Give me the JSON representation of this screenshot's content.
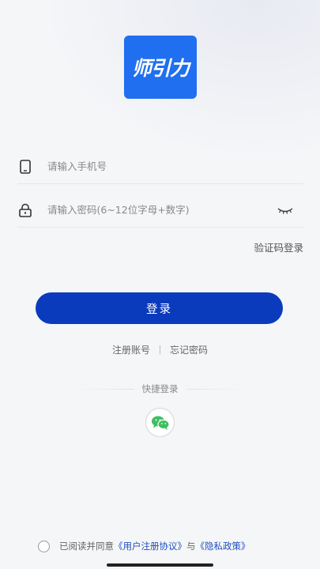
{
  "logo": {
    "text": "师引力"
  },
  "phone": {
    "placeholder": "请输入手机号"
  },
  "password": {
    "placeholder": "请输入密码(6~12位字母+数字)"
  },
  "sms_login": "验证码登录",
  "login_button": "登录",
  "links": {
    "register": "注册账号",
    "forgot": "忘记密码"
  },
  "quick_login": "快捷登录",
  "agreement": {
    "prefix": "已阅读并同意",
    "user_agreement": "《用户注册协议》",
    "and": "与",
    "privacy_policy": "《隐私政策》"
  },
  "colors": {
    "accent": "#0b3bbd",
    "logo_bg": "#1f6ff0",
    "wechat": "#3cc060",
    "link": "#1f4fc2"
  },
  "icons": {
    "phone": "phone-icon",
    "lock": "lock-icon",
    "eye": "eye-closed-icon",
    "wechat": "wechat-icon"
  }
}
